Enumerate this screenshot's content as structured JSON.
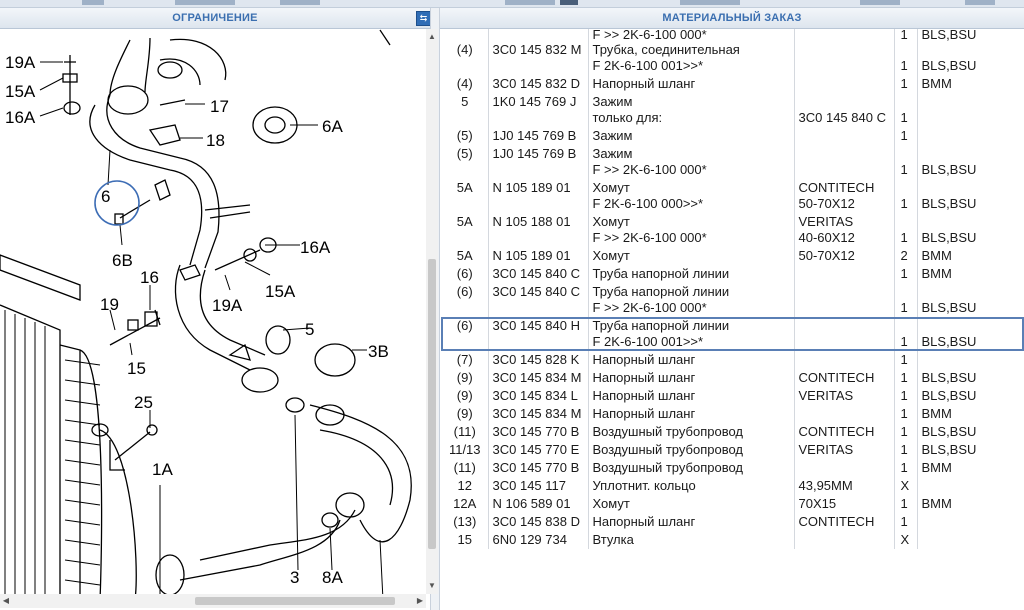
{
  "panels": {
    "left_title": "ОГРАНИЧЕНИЕ",
    "right_title": "МАТЕРИАЛЬНЫЙ ЗАКАЗ"
  },
  "diagram_labels": [
    "19A",
    "15A",
    "16A",
    "17",
    "18",
    "6A",
    "6",
    "6B",
    "16A",
    "15A",
    "19A",
    "16",
    "19",
    "15",
    "5",
    "3B",
    "25",
    "1A",
    "3",
    "8A"
  ],
  "rows": [
    {
      "pos": "",
      "part": "",
      "desc1": "F >> 2K-6-100 000*",
      "desc2": "",
      "note1": "",
      "note2": "",
      "qty": "1",
      "model": "BLS,BSU",
      "partial": true
    },
    {
      "pos": "(4)",
      "part": "3C0 145 832 M",
      "desc1": "Трубка, соединительная",
      "desc2": "F 2K-6-100 001>>*",
      "note1": "",
      "note2": "",
      "qty": "1",
      "model": "BLS,BSU"
    },
    {
      "pos": "(4)",
      "part": "3C0 145 832 D",
      "desc1": "Напорный шланг",
      "desc2": "",
      "note1": "",
      "note2": "",
      "qty": "1",
      "model": "BMM"
    },
    {
      "pos": "5",
      "part": "1K0 145 769 J",
      "desc1": "Зажим",
      "desc2": "только для:",
      "note1": "",
      "note2": "3C0 145 840 C",
      "qty": "1",
      "model": ""
    },
    {
      "pos": "(5)",
      "part": "1J0 145 769 B",
      "desc1": "Зажим",
      "desc2": "",
      "note1": "",
      "note2": "",
      "qty": "1",
      "model": ""
    },
    {
      "pos": "(5)",
      "part": "1J0 145 769 B",
      "desc1": "Зажим",
      "desc2": "F >> 2K-6-100 000*",
      "note1": "",
      "note2": "",
      "qty": "1",
      "model": "BLS,BSU"
    },
    {
      "pos": "5A",
      "part": "N  105 189 01",
      "desc1": "Хомут",
      "desc2": "F 2K-6-100 000>>*",
      "note1": "CONTITECH",
      "note2": "50-70X12",
      "qty": "1",
      "model": "BLS,BSU"
    },
    {
      "pos": "5A",
      "part": "N  105 188 01",
      "desc1": "Хомут",
      "desc2": "F >> 2K-6-100 000*",
      "note1": "VERITAS",
      "note2": "40-60X12",
      "qty": "1",
      "model": "BLS,BSU"
    },
    {
      "pos": "5A",
      "part": "N  105 189 01",
      "desc1": "Хомут",
      "desc2": "",
      "note1": "50-70X12",
      "note2": "",
      "qty": "2",
      "model": "BMM"
    },
    {
      "pos": "(6)",
      "part": "3C0 145 840 C",
      "desc1": "Труба напорной линии",
      "desc2": "",
      "note1": "",
      "note2": "",
      "qty": "1",
      "model": "BMM"
    },
    {
      "pos": "(6)",
      "part": "3C0 145 840 C",
      "desc1": "Труба напорной линии",
      "desc2": "F >> 2K-6-100 000*",
      "note1": "",
      "note2": "",
      "qty": "1",
      "model": "BLS,BSU"
    },
    {
      "pos": "(6)",
      "part": "3C0 145 840 H",
      "desc1": "Труба напорной линии",
      "desc2": "F 2K-6-100 001>>*",
      "note1": "",
      "note2": "",
      "qty": "1",
      "model": "BLS,BSU",
      "selected": true
    },
    {
      "pos": "(7)",
      "part": "3C0 145 828 K",
      "desc1": "Напорный шланг",
      "desc2": "",
      "note1": "",
      "note2": "",
      "qty": "1",
      "model": ""
    },
    {
      "pos": "(9)",
      "part": "3C0 145 834 M",
      "desc1": "Напорный шланг",
      "desc2": "",
      "note1": "CONTITECH",
      "note2": "",
      "qty": "1",
      "model": "BLS,BSU"
    },
    {
      "pos": "(9)",
      "part": "3C0 145 834 L",
      "desc1": "Напорный шланг",
      "desc2": "",
      "note1": "VERITAS",
      "note2": "",
      "qty": "1",
      "model": "BLS,BSU"
    },
    {
      "pos": "(9)",
      "part": "3C0 145 834 M",
      "desc1": "Напорный шланг",
      "desc2": "",
      "note1": "",
      "note2": "",
      "qty": "1",
      "model": "BMM"
    },
    {
      "pos": "(11)",
      "part": "3C0 145 770 B",
      "desc1": "Воздушный трубопровод",
      "desc2": "",
      "note1": "CONTITECH",
      "note2": "",
      "qty": "1",
      "model": "BLS,BSU"
    },
    {
      "pos": "11/13",
      "part": "3C0 145 770 E",
      "desc1": "Воздушный трубопровод",
      "desc2": "",
      "note1": "VERITAS",
      "note2": "",
      "qty": "1",
      "model": "BLS,BSU"
    },
    {
      "pos": "(11)",
      "part": "3C0 145 770 B",
      "desc1": "Воздушный трубопровод",
      "desc2": "",
      "note1": "",
      "note2": "",
      "qty": "1",
      "model": "BMM"
    },
    {
      "pos": "12",
      "part": "3C0 145 117",
      "desc1": "Уплотнит. кольцо",
      "desc2": "",
      "note1": "43,95MM",
      "note2": "",
      "qty": "X",
      "model": ""
    },
    {
      "pos": "12A",
      "part": "N  106 589 01",
      "desc1": "Хомут",
      "desc2": "",
      "note1": "70X15",
      "note2": "",
      "qty": "1",
      "model": "BMM"
    },
    {
      "pos": "(13)",
      "part": "3C0 145 838 D",
      "desc1": "Напорный шланг",
      "desc2": "",
      "note1": "CONTITECH",
      "note2": "",
      "qty": "1",
      "model": ""
    },
    {
      "pos": "15",
      "part": "6N0 129 734",
      "desc1": "Втулка",
      "desc2": "",
      "note1": "",
      "note2": "",
      "qty": "X",
      "model": ""
    }
  ]
}
